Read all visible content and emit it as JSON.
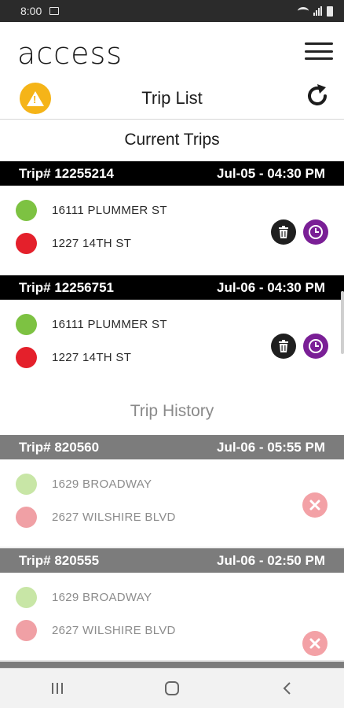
{
  "status_bar": {
    "time": "8:00"
  },
  "header": {
    "logo": "access",
    "title": "Trip List"
  },
  "sections": {
    "current": "Current Trips",
    "history": "Trip History"
  },
  "current_trips": [
    {
      "trip_no": "Trip# 12255214",
      "datetime": "Jul-05 - 04:30 PM",
      "pickup": "16111 PLUMMER ST",
      "dropoff": "1227 14TH ST"
    },
    {
      "trip_no": "Trip# 12256751",
      "datetime": "Jul-06 - 04:30 PM",
      "pickup": "16111 PLUMMER ST",
      "dropoff": "1227 14TH ST"
    }
  ],
  "history_trips": [
    {
      "trip_no": "Trip# 820560",
      "datetime": "Jul-06 - 05:55 PM",
      "pickup": "1629 BROADWAY",
      "dropoff": "2627 WILSHIRE BLVD"
    },
    {
      "trip_no": "Trip# 820555",
      "datetime": "Jul-06 - 02:50 PM",
      "pickup": "1629 BROADWAY",
      "dropoff": "2627 WILSHIRE BLVD"
    }
  ],
  "colors": {
    "pickup": "#7dc242",
    "dropoff": "#e4202b",
    "pickup_history": "#c8e6a6",
    "dropoff_history": "#f0a0a5",
    "warning": "#f5b418",
    "time_button": "#7a1f96"
  },
  "icons": [
    "warning-icon",
    "refresh-icon",
    "menu-icon",
    "trash-icon",
    "clock-icon",
    "cancel-icon",
    "recent-apps-icon",
    "home-icon",
    "back-icon"
  ]
}
